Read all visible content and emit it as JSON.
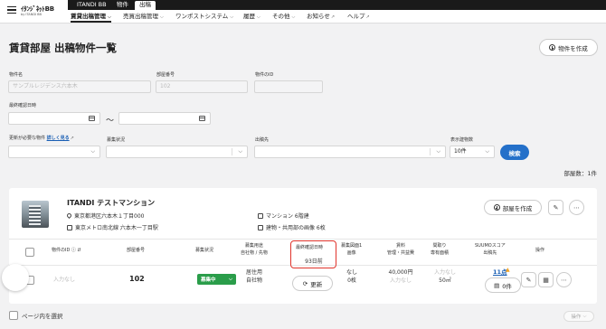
{
  "header": {
    "logo_line1": "ｲﾀﾝｼﾞﾈｯﾄBB",
    "logo_line2": "by ITANDI BB",
    "portal_tabs": [
      "ITANDI BB",
      "物件",
      "出稿"
    ],
    "menu": [
      {
        "label": "賃貸出稿管理",
        "active": true
      },
      {
        "label": "売買出稿管理",
        "active": false
      },
      {
        "label": "ワンポストシステム",
        "active": false
      },
      {
        "label": "履歴",
        "active": false
      },
      {
        "label": "その他",
        "active": false
      },
      {
        "label": "お知らせ",
        "active": false
      },
      {
        "label": "ヘルプ",
        "active": false
      }
    ]
  },
  "page": {
    "title": "賃貸部屋 出稿物件一覧",
    "create_button": "物件を作成"
  },
  "filters": {
    "property_name_label": "物件名",
    "property_name_placeholder": "サンプルレジデンス六本木",
    "room_number_label": "部屋番号",
    "room_number_placeholder": "102",
    "property_id_label": "物件のID",
    "last_confirmed_label": "最終確認日時",
    "date_separator": "〜",
    "update_needed_label": "更新が必要な物件",
    "update_needed_link": "詳しく見る",
    "recruit_status_label": "募集状況",
    "destination_label": "出稿先",
    "display_count_label": "表示建物数",
    "display_count_value": "10件",
    "search_button": "検索"
  },
  "result": {
    "room_count": "部屋数：1件"
  },
  "property": {
    "name": "ITANDI テストマンション",
    "address": "東京都港区六本木１丁目000",
    "station": "東京メトロ南北線 六本木一丁目駅",
    "building_type": "マンション 6階建",
    "images": "建物・共用部の画像 6枚",
    "create_room_button": "部屋を作成"
  },
  "table": {
    "headers": {
      "property_id": "物件のID",
      "room_number": "部屋番号",
      "recruit_status": "募集状況",
      "usage_line1": "募集用途",
      "usage_line2": "自社物 / 先物",
      "last_confirmed": "最終確認日時",
      "floor_plan_line1": "募集図面1",
      "floor_plan_line2": "画像",
      "fee_line1": "賃料",
      "fee_line2": "管理・共益費",
      "layout_line1": "間取り",
      "layout_line2": "専有面積",
      "suumo_line1": "SUUMOスコア",
      "suumo_line2": "出稿先",
      "actions": "操作"
    },
    "row": {
      "property_id": "入力なし",
      "room_number": "102",
      "recruit_status": "募集中",
      "usage_line1": "居住用",
      "usage_line2": "自社物",
      "last_confirmed": "93日前",
      "refresh_button": "更新",
      "floor_plan": "なし",
      "floor_plan_count": "0枚",
      "rent": "40,000円",
      "management_fee": "入力なし",
      "layout": "入力なし",
      "area": "50㎡",
      "suumo_score": "11点",
      "destinations": "0件"
    }
  },
  "footer": {
    "select_page": "ページ内を選択",
    "operations": "操作"
  },
  "colors": {
    "primary": "#2470c9",
    "success": "#2a9d4a",
    "highlight": "#e0342c",
    "warning": "#f0a020"
  }
}
